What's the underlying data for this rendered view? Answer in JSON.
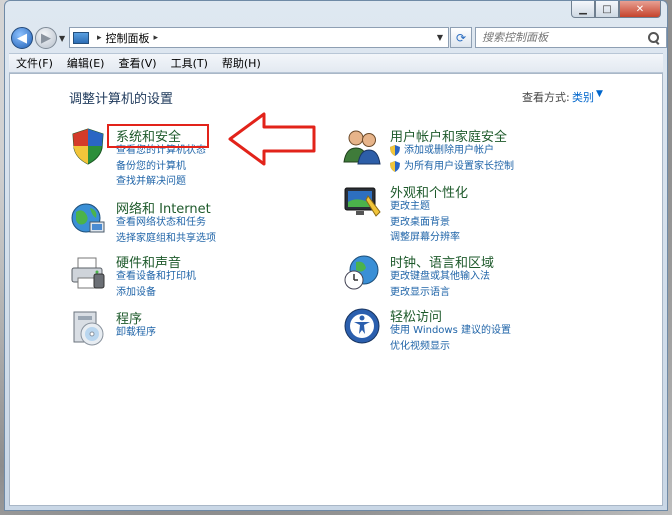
{
  "window": {
    "caption_buttons": {
      "minimize": "▁",
      "maximize": "□",
      "close": "✕"
    }
  },
  "address": {
    "path": "控制面板",
    "separator": "▸"
  },
  "search": {
    "placeholder": "搜索控制面板"
  },
  "menu": [
    "文件(F)",
    "编辑(E)",
    "查看(V)",
    "工具(T)",
    "帮助(H)"
  ],
  "page": {
    "title": "调整计算机的设置",
    "view_by_label": "查看方式:",
    "view_by_value": "类别"
  },
  "categories": [
    {
      "title": "系统和安全",
      "icon": "shield-icon",
      "links": [
        "查看您的计算机状态",
        "备份您的计算机",
        "查找并解决问题"
      ]
    },
    {
      "title": "网络和 Internet",
      "icon": "network-globe-icon",
      "links": [
        "查看网络状态和任务",
        "选择家庭组和共享选项"
      ]
    },
    {
      "title": "硬件和声音",
      "icon": "printer-icon",
      "links": [
        "查看设备和打印机",
        "添加设备"
      ]
    },
    {
      "title": "程序",
      "icon": "programs-disc-icon",
      "links": [
        "卸载程序"
      ]
    },
    {
      "title": "用户帐户和家庭安全",
      "icon": "users-icon",
      "links": [
        "添加或删除用户帐户",
        "为所有用户设置家长控制"
      ]
    },
    {
      "title": "外观和个性化",
      "icon": "monitor-paint-icon",
      "links": [
        "更改主题",
        "更改桌面背景",
        "调整屏幕分辨率"
      ]
    },
    {
      "title": "时钟、语言和区域",
      "icon": "clock-globe-icon",
      "links": [
        "更改键盘或其他输入法",
        "更改显示语言"
      ]
    },
    {
      "title": "轻松访问",
      "icon": "ease-of-access-icon",
      "links": [
        "使用 Windows 建议的设置",
        "优化视频显示"
      ]
    }
  ],
  "colors": {
    "highlight": "#e2231a",
    "link": "#1f64a8",
    "category_title": "#1e5a2b"
  }
}
